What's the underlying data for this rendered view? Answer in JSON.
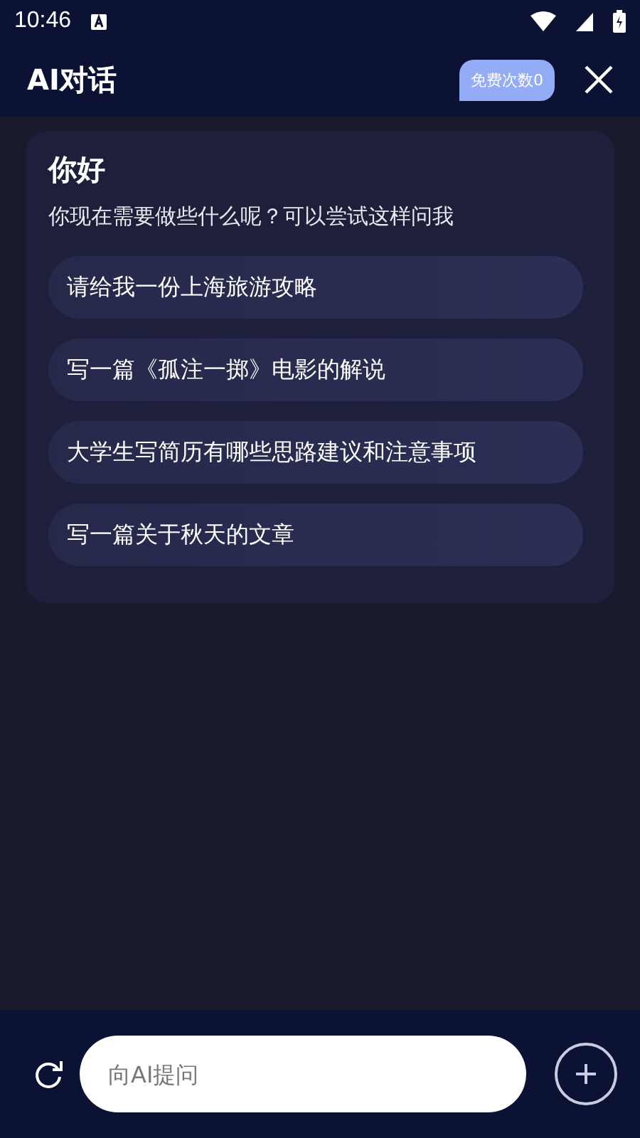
{
  "status_bar": {
    "time": "10:46"
  },
  "header": {
    "title": "AI对话",
    "badge": "免费次数0"
  },
  "card": {
    "greeting": "你好",
    "prompt": "你现在需要做些什么呢？可以尝试这样问我",
    "suggestions": [
      "请给我一份上海旅游攻略",
      "写一篇《孤注一掷》电影的解说",
      "大学生写简历有哪些思路建议和注意事项",
      "写一篇关于秋天的文章"
    ]
  },
  "input": {
    "placeholder": "向AI提问"
  }
}
